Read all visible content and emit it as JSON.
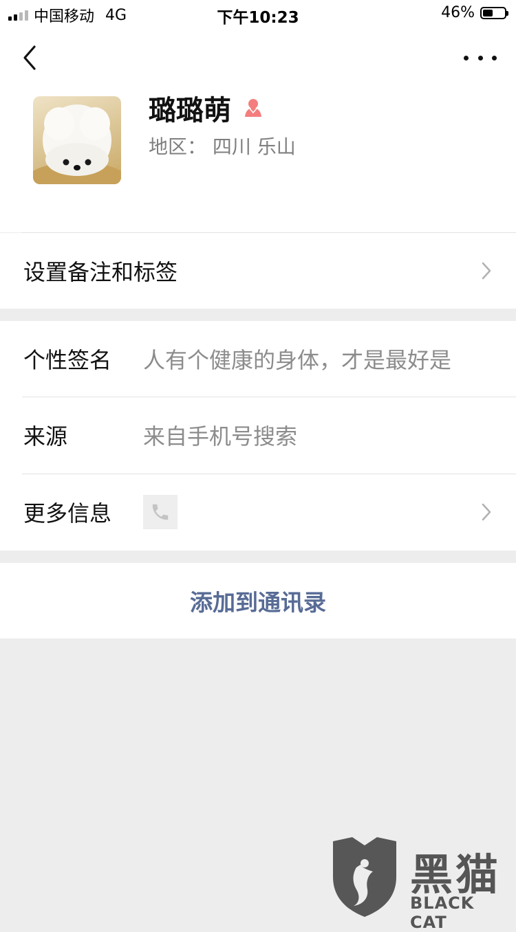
{
  "status_bar": {
    "carrier": "中国移动",
    "network": "4G",
    "time": "下午10:23",
    "battery": "46%",
    "battery_level": 0.46
  },
  "nav": {
    "back_icon": "chevron-left-icon",
    "more_icon": "more-dots-icon"
  },
  "profile": {
    "nickname": "璐璐萌",
    "gender_icon": "female-icon",
    "gender_color": "#f37e7d",
    "region": "地区：  四川 乐山"
  },
  "remark_row": {
    "label": "设置备注和标签"
  },
  "info": {
    "signature_label": "个性签名",
    "signature_value": "人有个健康的身体，才是最好是",
    "source_label": "来源",
    "source_value": "来自手机号搜索",
    "more_label": "更多信息",
    "more_icon": "phone-icon"
  },
  "action": {
    "add_contact": "添加到通讯录",
    "color": "#576b95"
  },
  "watermark": {
    "title": "黑猫",
    "subtitle": "BLACK CAT"
  }
}
